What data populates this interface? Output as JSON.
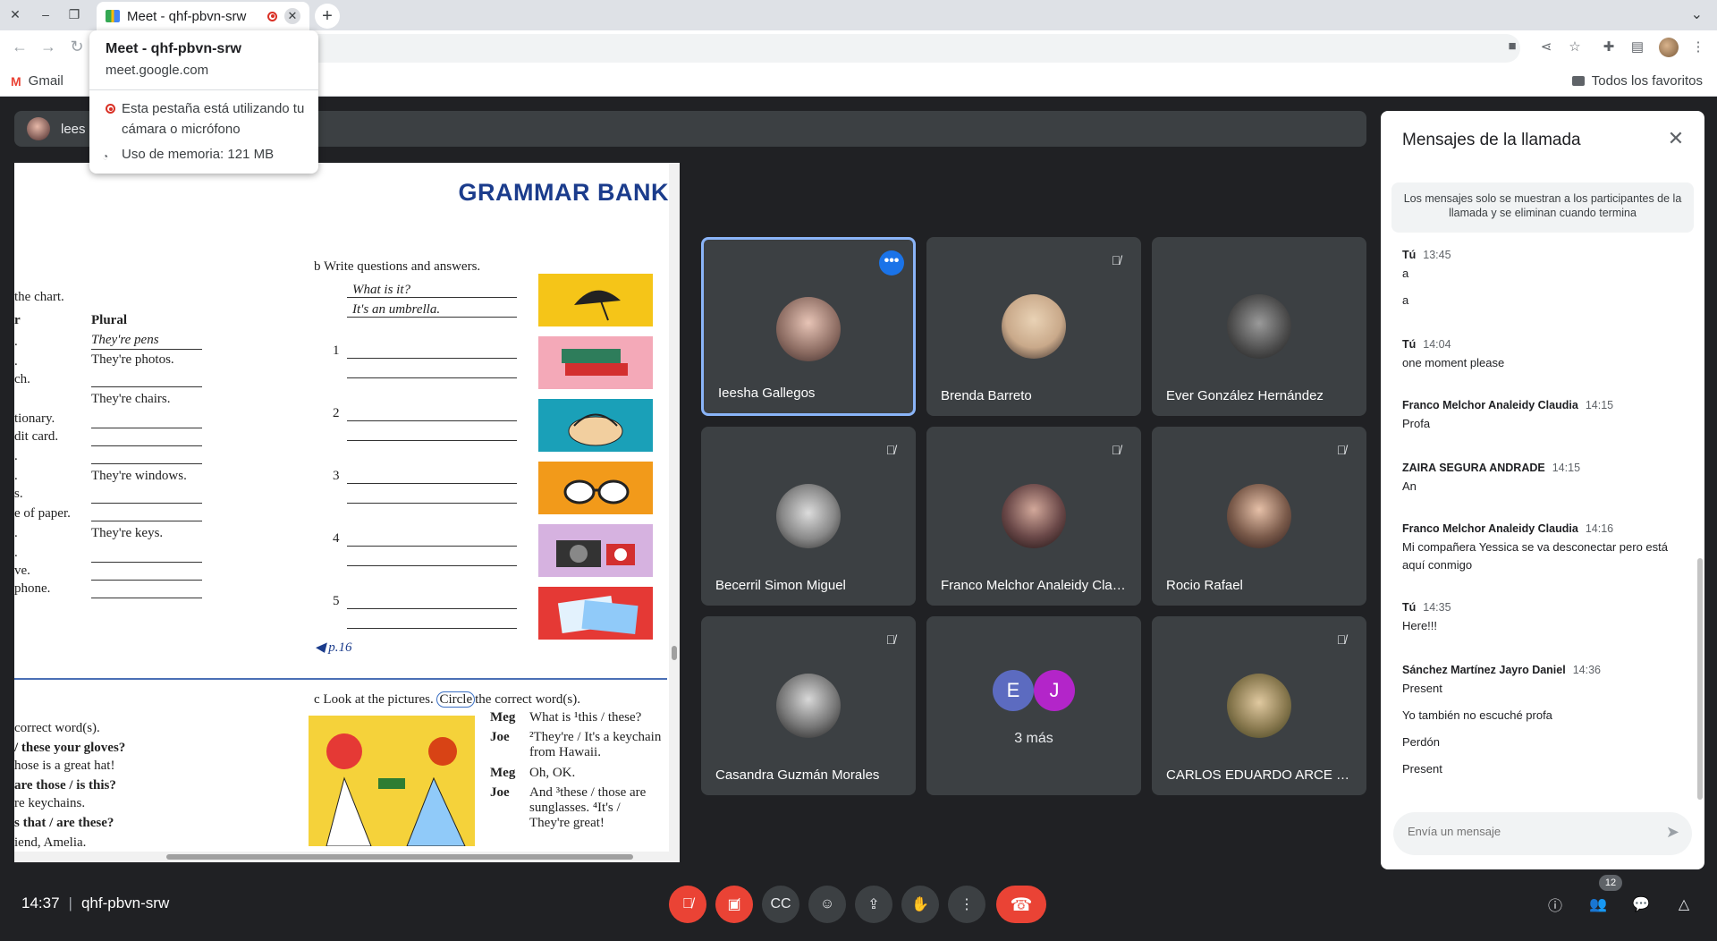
{
  "browser": {
    "tab_title": "Meet - qhf-pbvn-srw",
    "tab_close": "✕",
    "new_tab": "+",
    "bookmarks": {
      "gmail": "Gmail",
      "all": "Todos los favoritos"
    }
  },
  "hovercard": {
    "title": "Meet - qhf-pbvn-srw",
    "url": "meet.google.com",
    "warning": "Esta pestaña está utilizando tu cámara o micrófono",
    "memory": "Uso de memoria: 121 MB"
  },
  "presenter": {
    "name": "lees"
  },
  "slide": {
    "title": "GRAMMAR BANK",
    "b_heading": "b  Write questions and answers.",
    "example_q": "What is it?",
    "example_a": "It's an umbrella.",
    "nums": [
      "1",
      "2",
      "3",
      "4",
      "5"
    ],
    "page_ref": "p.16",
    "chart_text": "the chart.",
    "col_r": "r",
    "col_plural": "Plural",
    "plural_rows": [
      "They're pens",
      "They're photos.",
      "They're chairs.",
      "They're windows.",
      "They're keys."
    ],
    "left_fragments": [
      ".",
      ".",
      "ch.",
      "tionary.",
      "dit card.",
      ".",
      ".",
      "s.",
      "e of paper.",
      ".",
      ".",
      "ve.",
      "phone."
    ],
    "c_heading": "c  Look at the pictures.",
    "c_circle": "Circle",
    "c_rest": "the correct word(s).",
    "left_c": [
      "correct word(s).",
      "/ these your gloves?",
      "hose is a great hat!",
      "are those / is this?",
      "re keychains.",
      "s that / are these?",
      "iend, Amelia."
    ],
    "dialogue": [
      {
        "speaker": "Meg",
        "line": "What is ¹this / these?"
      },
      {
        "speaker": "Joe",
        "line": "²They're / It's a keychain from Hawaii."
      },
      {
        "speaker": "Meg",
        "line": "Oh, OK."
      },
      {
        "speaker": "Joe",
        "line": "And ³these / those are sunglasses. ⁴It's / They're great!"
      }
    ]
  },
  "participants": [
    {
      "name": "Ieesha Gallegos",
      "active": true,
      "muted": false,
      "photo": "#8a6a60"
    },
    {
      "name": "Brenda Barreto",
      "active": false,
      "muted": true,
      "photo": "#c9a98a"
    },
    {
      "name": "Ever González Hernández",
      "active": false,
      "muted": false,
      "photo": "#5a5a5a"
    },
    {
      "name": "Becerril Simon Miguel",
      "active": false,
      "muted": true,
      "photo": "#888888"
    },
    {
      "name": "Franco Melchor Analeidy Cla…",
      "active": false,
      "muted": true,
      "photo": "#6a4848"
    },
    {
      "name": "Rocio Rafael",
      "active": false,
      "muted": true,
      "photo": "#7a5a4a"
    },
    {
      "name": "Casandra Guzmán Morales",
      "active": false,
      "muted": true,
      "photo": "#777777"
    },
    {
      "name": "",
      "active": false,
      "muted": false,
      "photo": ""
    },
    {
      "name": "CARLOS EDUARDO ARCE HE…",
      "active": false,
      "muted": true,
      "photo": "#8a7a50"
    }
  ],
  "more_tile": {
    "avatar1": "E",
    "avatar2": "J",
    "label": "3 más",
    "color1": "#5c6bc0",
    "color2": "#b325c9"
  },
  "chat": {
    "title": "Mensajes de la llamada",
    "note": "Los mensajes solo se muestran a los participantes de la llamada y se eliminan cuando termina",
    "messages": [
      {
        "sender": "Tú",
        "time": "13:45",
        "lines": [
          "a",
          "a"
        ]
      },
      {
        "sender": "Tú",
        "time": "14:04",
        "lines": [
          "one moment please"
        ]
      },
      {
        "sender": "Franco Melchor Analeidy Claudia",
        "time": "14:15",
        "lines": [
          "Profa"
        ]
      },
      {
        "sender": "ZAIRA SEGURA ANDRADE",
        "time": "14:15",
        "lines": [
          "An"
        ]
      },
      {
        "sender": "Franco Melchor Analeidy Claudia",
        "time": "14:16",
        "lines": [
          "Mi compañera Yessica se va desconectar  pero está aquí conmigo"
        ]
      },
      {
        "sender": "Tú",
        "time": "14:35",
        "lines": [
          "Here!!!"
        ]
      },
      {
        "sender": "Sánchez Martínez Jayro Daniel",
        "time": "14:36",
        "lines": [
          "Present",
          "Yo también no escuché profa",
          "Perdón",
          "Present"
        ]
      }
    ],
    "input_placeholder": "Envía un mensaje"
  },
  "bottom": {
    "time": "14:37",
    "meeting_code": "qhf-pbvn-srw",
    "people_count": "12"
  }
}
